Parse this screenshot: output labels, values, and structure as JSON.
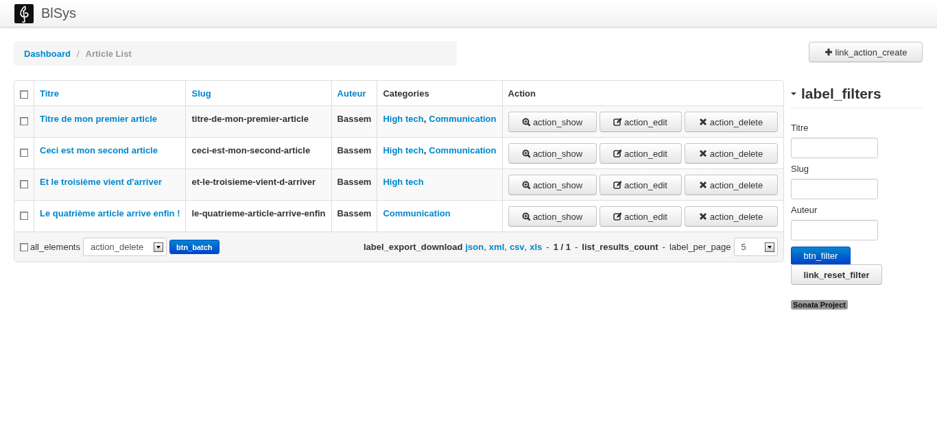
{
  "app": {
    "title": "BlSys"
  },
  "breadcrumb": [
    {
      "label": "Dashboard",
      "kind": "link"
    },
    {
      "label": "/",
      "kind": "divider"
    },
    {
      "label": "Article List",
      "kind": "current"
    }
  ],
  "create_button": {
    "label": "link_action_create"
  },
  "table": {
    "select_all_checked": false,
    "columns": [
      {
        "label": "Titre",
        "sortable": true
      },
      {
        "label": "Slug",
        "sortable": true
      },
      {
        "label": "Auteur",
        "sortable": true
      },
      {
        "label": "Categories",
        "sortable": false
      },
      {
        "label": "Action",
        "sortable": false
      }
    ],
    "category_separator": ",",
    "rows": [
      {
        "checked": false,
        "title": "Titre de mon premier article",
        "slug": "titre-de-mon-premier-article",
        "author": "Bassem",
        "categories": [
          "High tech",
          "Communication"
        ],
        "actions": [
          {
            "kind": "show",
            "label": "action_show"
          },
          {
            "kind": "edit",
            "label": "action_edit"
          },
          {
            "kind": "delete",
            "label": "action_delete"
          }
        ]
      },
      {
        "checked": false,
        "title": "Ceci est mon second article",
        "slug": "ceci-est-mon-second-article",
        "author": "Bassem",
        "categories": [
          "High tech",
          "Communication"
        ],
        "actions": [
          {
            "kind": "show",
            "label": "action_show"
          },
          {
            "kind": "edit",
            "label": "action_edit"
          },
          {
            "kind": "delete",
            "label": "action_delete"
          }
        ]
      },
      {
        "checked": false,
        "title": "Et le troisième vient d'arriver",
        "slug": "et-le-troisieme-vient-d-arriver",
        "author": "Bassem",
        "categories": [
          "High tech"
        ],
        "actions": [
          {
            "kind": "show",
            "label": "action_show"
          },
          {
            "kind": "edit",
            "label": "action_edit"
          },
          {
            "kind": "delete",
            "label": "action_delete"
          }
        ]
      },
      {
        "checked": false,
        "title": "Le quatrième article arrive enfin !",
        "slug": "le-quatrieme-article-arrive-enfin",
        "author": "Bassem",
        "categories": [
          "Communication"
        ],
        "actions": [
          {
            "kind": "show",
            "label": "action_show"
          },
          {
            "kind": "edit",
            "label": "action_edit"
          },
          {
            "kind": "delete",
            "label": "action_delete"
          }
        ]
      }
    ],
    "footer": {
      "all_elements": {
        "label": "all_elements",
        "checked": false
      },
      "batch_action": "action_delete",
      "batch_button": "btn_batch",
      "export_label": "label_export_download",
      "formats": [
        "json",
        "xml",
        "csv",
        "xls"
      ],
      "format_separator": ",",
      "separator": "-",
      "pages": "1 / 1",
      "results_count": "list_results_count",
      "per_page_label": "label_per_page",
      "per_page": "5"
    }
  },
  "filters": {
    "title": "label_filters",
    "expanded": true,
    "fields": [
      {
        "label": "Titre"
      },
      {
        "label": "Slug"
      },
      {
        "label": "Auteur"
      }
    ],
    "filter_button": "btn_filter",
    "reset_button": "link_reset_filter"
  },
  "badge": "Sonata Project"
}
